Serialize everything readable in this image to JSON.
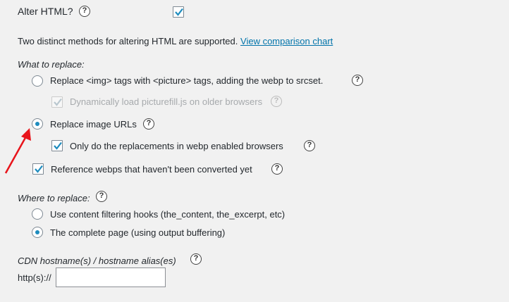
{
  "alter_html": {
    "label": "Alter HTML?",
    "help_icon": "question-circle-icon",
    "checked": true
  },
  "description": {
    "text": "Two distinct methods for altering HTML are supported.",
    "link": "View comparison chart"
  },
  "what_to_replace": {
    "heading": "What to replace:",
    "options": [
      {
        "label": "Replace <img> tags with <picture> tags, adding the webp to srcset.",
        "selected": false
      },
      {
        "label": "Replace image URLs",
        "selected": true
      }
    ],
    "picturefill": {
      "label": "Dynamically load picturefill.js on older browsers",
      "checked": true,
      "disabled": true
    },
    "only_webp_browsers": {
      "label": "Only do the replacements in webp enabled browsers",
      "checked": true
    },
    "reference_unconverted": {
      "label": "Reference webps that haven't been converted yet",
      "checked": true
    }
  },
  "where_to_replace": {
    "heading": "Where to replace:",
    "options": [
      {
        "label": "Use content filtering hooks (the_content, the_excerpt, etc)",
        "selected": false
      },
      {
        "label": "The complete page (using output buffering)",
        "selected": true
      }
    ]
  },
  "cdn": {
    "heading": "CDN hostname(s) / hostname alias(es)",
    "prefix": "http(s)://",
    "value": ""
  },
  "annotation": {
    "arrow_color": "#e8141b",
    "accent_color": "#1e8cbe"
  }
}
